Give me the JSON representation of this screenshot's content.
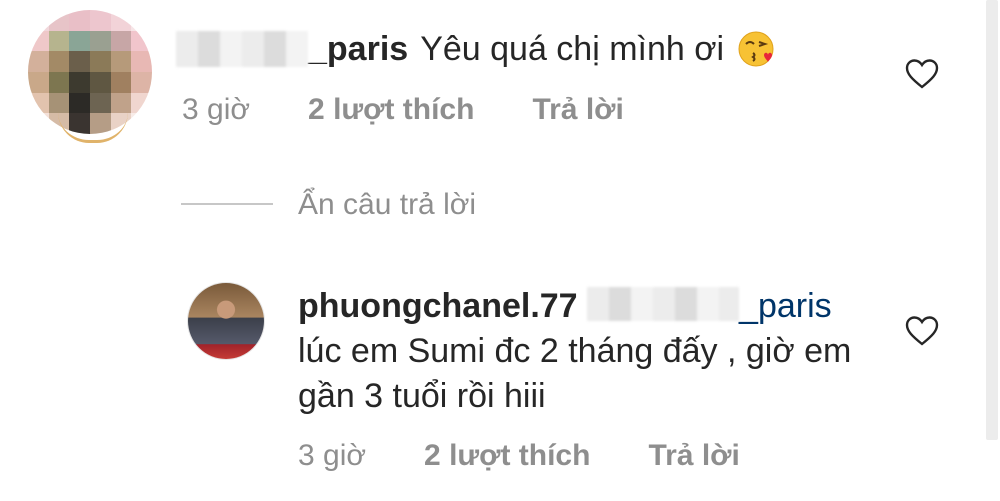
{
  "comment": {
    "username_suffix": "_paris",
    "text": "Yêu quá chị mình ơi",
    "emoji_icon": "face-throwing-kiss-icon",
    "time": "3 giờ",
    "likes": "2 lượt thích",
    "reply_label": "Trả lời",
    "like_icon": "heart-outline-icon"
  },
  "hide_replies": {
    "label": "Ẩn câu trả lời"
  },
  "reply": {
    "username": "phuongchanel.77",
    "mention_suffix": "_paris",
    "text": "lúc em Sumi đc 2 tháng đấy , giờ em gần 3 tuổi rồi hiii",
    "time": "3 giờ",
    "likes": "2 lượt thích",
    "reply_label": "Trả lời",
    "like_icon": "heart-outline-icon"
  },
  "colors": {
    "text_primary": "#262626",
    "text_secondary": "#8e8e8e",
    "mention": "#003569",
    "divider": "#c7c7c7"
  }
}
